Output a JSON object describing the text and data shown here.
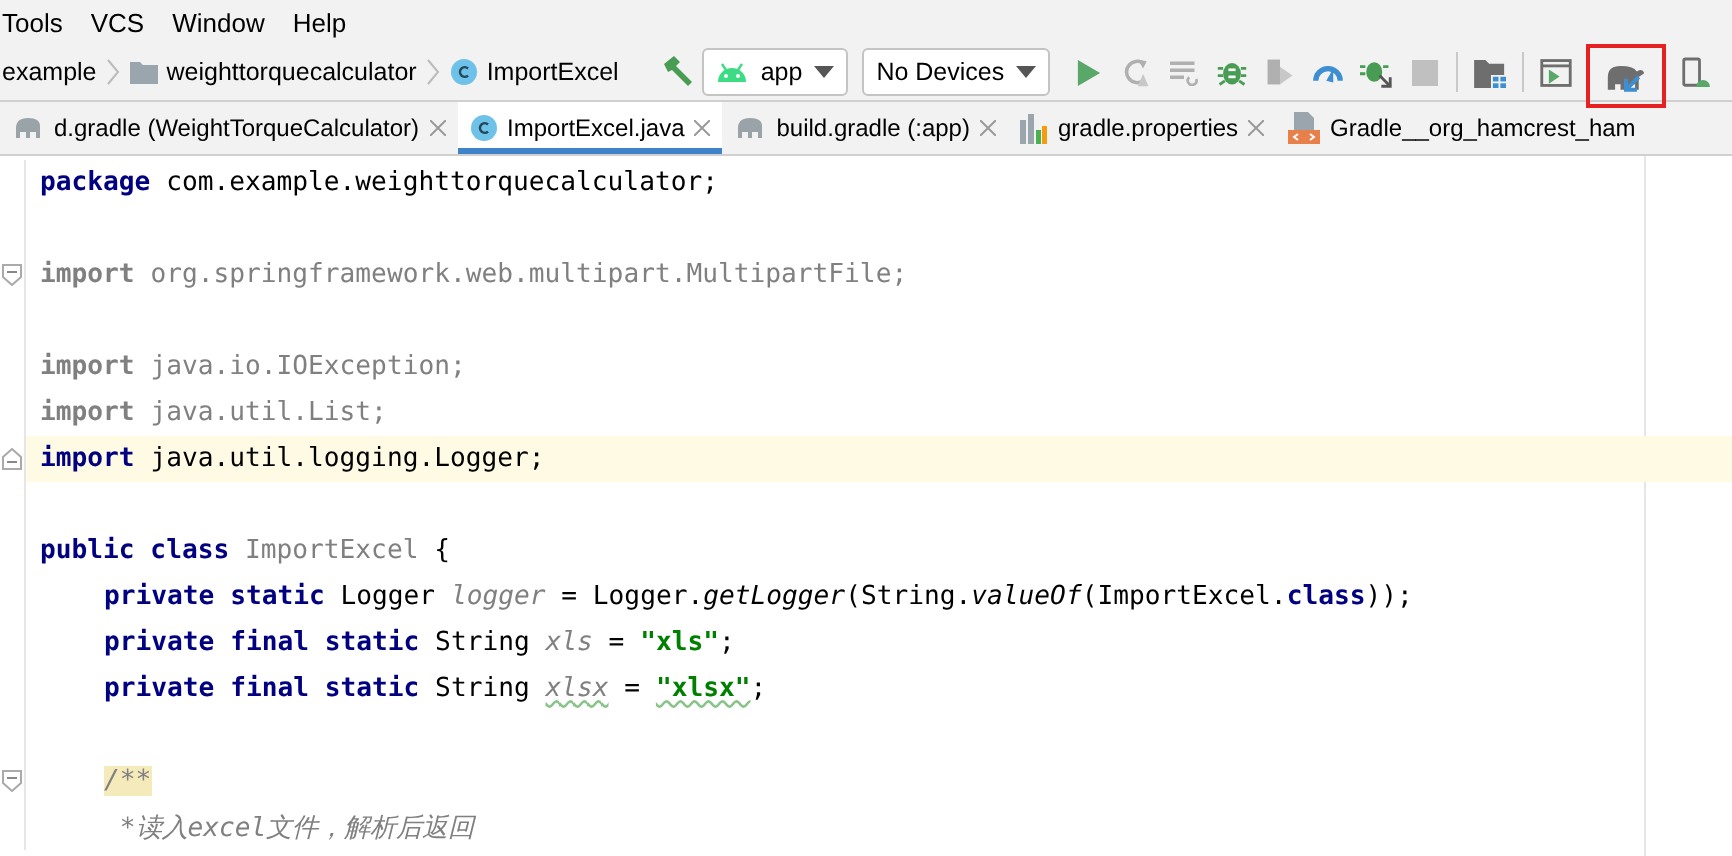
{
  "menu": [
    {
      "label": "Tools"
    },
    {
      "label": "VCS"
    },
    {
      "label": "Window"
    },
    {
      "label": "Help"
    }
  ],
  "breadcrumb": [
    {
      "kind": "text",
      "label": "example"
    },
    {
      "kind": "folder",
      "label": "weighttorquecalculator"
    },
    {
      "kind": "class",
      "label": "ImportExcel"
    }
  ],
  "toolbar": [
    {
      "kind": "hammer",
      "highlighted": false
    },
    {
      "kind": "target-dropdown",
      "label": "app"
    },
    {
      "kind": "device-dropdown",
      "label": "No Devices"
    },
    {
      "kind": "run",
      "highlighted": false
    },
    {
      "kind": "apply-changes",
      "highlighted": false
    },
    {
      "kind": "apply-code",
      "highlighted": false
    },
    {
      "kind": "debug",
      "highlighted": false
    },
    {
      "kind": "attach",
      "highlighted": false
    },
    {
      "kind": "profile",
      "highlighted": false
    },
    {
      "kind": "attach-debugger",
      "highlighted": false
    },
    {
      "kind": "stop",
      "highlighted": false
    },
    {
      "kind": "divider"
    },
    {
      "kind": "project-structure",
      "highlighted": false
    },
    {
      "kind": "divider"
    },
    {
      "kind": "layout",
      "highlighted": false
    },
    {
      "kind": "gradle-sync",
      "highlighted": true
    },
    {
      "kind": "device",
      "highlighted": false
    }
  ],
  "tabs": [
    {
      "kind": "gradle",
      "label": "d.gradle (WeightTorqueCalculator)",
      "selected": false,
      "closable": true
    },
    {
      "kind": "class",
      "label": "ImportExcel.java",
      "selected": true,
      "closable": true
    },
    {
      "kind": "gradle",
      "label": "build.gradle (:app)",
      "selected": false,
      "closable": true
    },
    {
      "kind": "properties",
      "label": "gradle.properties",
      "selected": false,
      "closable": true
    },
    {
      "kind": "library",
      "label": "Gradle__org_hamcrest_ham",
      "selected": false,
      "closable": false
    }
  ],
  "editor": {
    "lines": [
      {
        "kind": "code",
        "indented": false,
        "current": false,
        "fold_start": false,
        "fold_end": false,
        "tokens": [
          {
            "kind": "keyword",
            "text": "package"
          },
          {
            "kind": "plain",
            "text": " com.example.weighttorquecalculator;"
          }
        ]
      },
      {
        "kind": "blank",
        "current": false,
        "fold_start": false,
        "fold_end": false
      },
      {
        "kind": "code",
        "indented": false,
        "current": false,
        "fold_start": true,
        "fold_end": false,
        "tokens": [
          {
            "kind": "unused-keyword",
            "text": "import"
          },
          {
            "kind": "unused",
            "text": " org.springframework.web.multipart.MultipartFile;"
          }
        ]
      },
      {
        "kind": "blank",
        "current": false,
        "fold_start": false,
        "fold_end": false
      },
      {
        "kind": "code",
        "indented": false,
        "current": false,
        "fold_start": false,
        "fold_end": false,
        "tokens": [
          {
            "kind": "unused-keyword",
            "text": "import"
          },
          {
            "kind": "unused",
            "text": " java.io.IOException;"
          }
        ]
      },
      {
        "kind": "code",
        "indented": false,
        "current": false,
        "fold_start": false,
        "fold_end": false,
        "tokens": [
          {
            "kind": "unused-keyword",
            "text": "import"
          },
          {
            "kind": "unused",
            "text": " java.util.List;"
          }
        ]
      },
      {
        "kind": "code",
        "indented": false,
        "current": true,
        "fold_start": false,
        "fold_end": true,
        "tokens": [
          {
            "kind": "keyword",
            "text": "import"
          },
          {
            "kind": "plain",
            "text": " java.util.logging.Logger;"
          }
        ]
      },
      {
        "kind": "blank",
        "current": false,
        "fold_start": false,
        "fold_end": false
      },
      {
        "kind": "code",
        "indented": false,
        "current": false,
        "fold_start": false,
        "fold_end": false,
        "tokens": [
          {
            "kind": "keyword",
            "text": "public class"
          },
          {
            "kind": "unused",
            "text": " ImportExcel"
          },
          {
            "kind": "plain",
            "text": " {"
          }
        ]
      },
      {
        "kind": "code",
        "indented": true,
        "current": false,
        "fold_start": false,
        "fold_end": false,
        "tokens": [
          {
            "kind": "keyword",
            "text": "private static"
          },
          {
            "kind": "plain",
            "text": " Logger "
          },
          {
            "kind": "unused-field",
            "text": "logger"
          },
          {
            "kind": "plain",
            "text": " = Logger."
          },
          {
            "kind": "call",
            "text": "getLogger"
          },
          {
            "kind": "plain",
            "text": "(String."
          },
          {
            "kind": "call",
            "text": "valueOf"
          },
          {
            "kind": "plain",
            "text": "(ImportExcel."
          },
          {
            "kind": "keyword",
            "text": "class"
          },
          {
            "kind": "plain",
            "text": "));"
          }
        ]
      },
      {
        "kind": "code",
        "indented": true,
        "current": false,
        "fold_start": false,
        "fold_end": false,
        "tokens": [
          {
            "kind": "keyword",
            "text": "private final static"
          },
          {
            "kind": "plain",
            "text": " String "
          },
          {
            "kind": "unused-field",
            "text": "xls"
          },
          {
            "kind": "plain",
            "text": " = "
          },
          {
            "kind": "string",
            "text": "\"xls\""
          },
          {
            "kind": "plain",
            "text": ";"
          }
        ]
      },
      {
        "kind": "code",
        "indented": true,
        "current": false,
        "fold_start": false,
        "fold_end": false,
        "tokens": [
          {
            "kind": "keyword",
            "text": "private final static"
          },
          {
            "kind": "plain",
            "text": " String "
          },
          {
            "kind": "typo-field",
            "text": "xlsx"
          },
          {
            "kind": "plain",
            "text": " = "
          },
          {
            "kind": "typo-string",
            "text": "\"xlsx\""
          },
          {
            "kind": "plain",
            "text": ";"
          }
        ]
      },
      {
        "kind": "blank",
        "current": false,
        "fold_start": false,
        "fold_end": false
      },
      {
        "kind": "code",
        "indented": true,
        "current": false,
        "fold_start": true,
        "fold_end": false,
        "tokens": [
          {
            "kind": "comment-mark",
            "text": "/**"
          }
        ]
      },
      {
        "kind": "code",
        "indented": true,
        "current": false,
        "fold_start": false,
        "fold_end": false,
        "tokens": [
          {
            "kind": "comment",
            "text": " *读入excel文件，解析后返回"
          }
        ]
      }
    ]
  }
}
